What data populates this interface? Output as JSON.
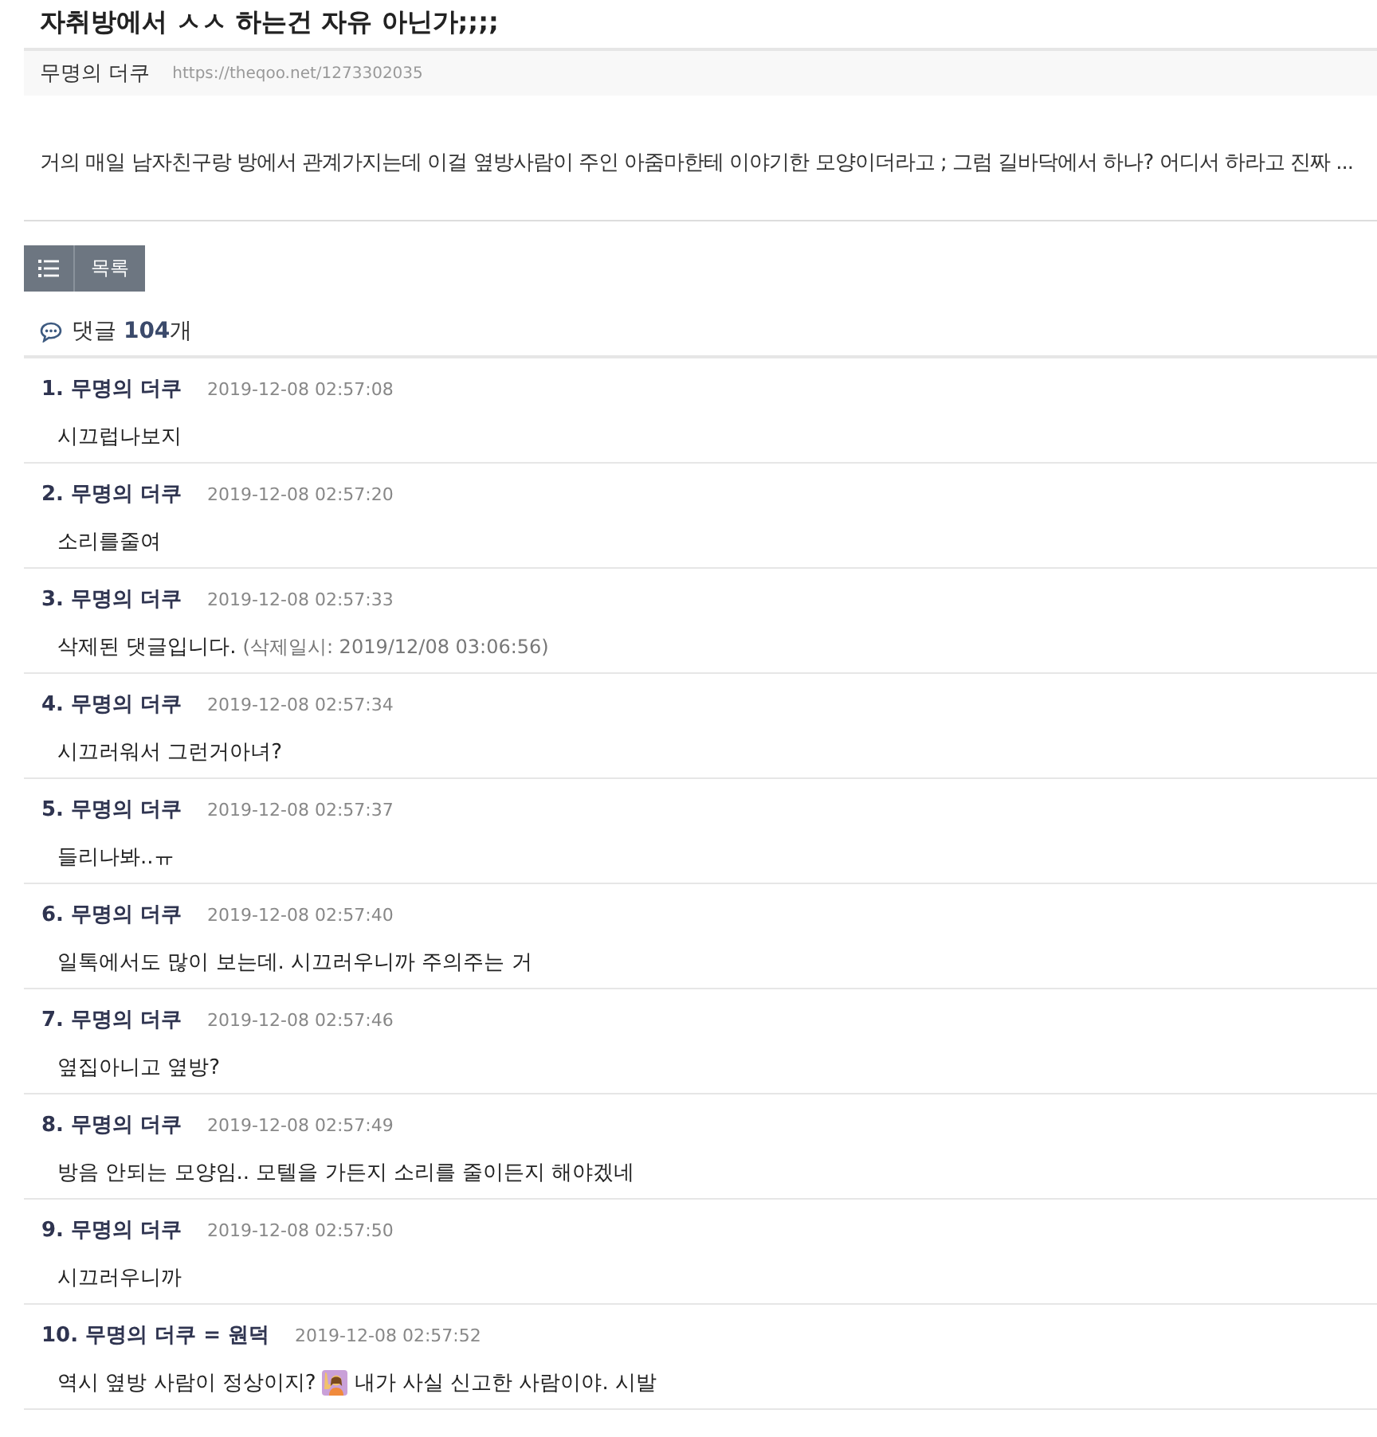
{
  "title": "자취방에서 ㅅㅅ 하는건 자유 아닌가;;;;",
  "meta": {
    "author": "무명의 더쿠",
    "url": "https://theqoo.net/1273302035"
  },
  "body": "거의 매일 남자친구랑 방에서 관계가지는데 이걸 옆방사람이 주인 아줌마한테 이야기한 모양이더라고 ; 그럼 길바닥에서 하나? 어디서 하라고 진짜 ...",
  "list_button": {
    "label": "목록"
  },
  "comment_count": {
    "label": "댓글",
    "count": "104",
    "unit": "개"
  },
  "comments": [
    {
      "number": "1.",
      "author": "무명의 더쿠",
      "time": "2019-12-08 02:57:08",
      "parts": [
        {
          "kind": "text",
          "text": "시끄럽나보지"
        }
      ]
    },
    {
      "number": "2.",
      "author": "무명의 더쿠",
      "time": "2019-12-08 02:57:20",
      "parts": [
        {
          "kind": "text",
          "text": "소리를줄여"
        }
      ]
    },
    {
      "number": "3.",
      "author": "무명의 더쿠",
      "time": "2019-12-08 02:57:33",
      "parts": [
        {
          "kind": "text",
          "text": "삭제된 댓글입니다."
        },
        {
          "kind": "note",
          "text": "(삭제일시: 2019/12/08 03:06:56)"
        }
      ]
    },
    {
      "number": "4.",
      "author": "무명의 더쿠",
      "time": "2019-12-08 02:57:34",
      "parts": [
        {
          "kind": "text",
          "text": "시끄러워서 그런거아녀?"
        }
      ]
    },
    {
      "number": "5.",
      "author": "무명의 더쿠",
      "time": "2019-12-08 02:57:37",
      "parts": [
        {
          "kind": "text",
          "text": "들리나봐..ㅠ"
        }
      ]
    },
    {
      "number": "6.",
      "author": "무명의 더쿠",
      "time": "2019-12-08 02:57:40",
      "parts": [
        {
          "kind": "text",
          "text": "일톡에서도 많이 보는데. 시끄러우니까 주의주는 거"
        }
      ]
    },
    {
      "number": "7.",
      "author": "무명의 더쿠",
      "time": "2019-12-08 02:57:46",
      "parts": [
        {
          "kind": "text",
          "text": "옆집아니고 옆방?"
        }
      ]
    },
    {
      "number": "8.",
      "author": "무명의 더쿠",
      "time": "2019-12-08 02:57:49",
      "parts": [
        {
          "kind": "text",
          "text": "방음 안되는 모양임.. 모텔을 가든지 소리를 줄이든지 해야겠네"
        }
      ]
    },
    {
      "number": "9.",
      "author": "무명의 더쿠",
      "time": "2019-12-08 02:57:50",
      "parts": [
        {
          "kind": "text",
          "text": "시끄러우니까"
        }
      ]
    },
    {
      "number": "10.",
      "author": "무명의 더쿠 = 원덕",
      "time": "2019-12-08 02:57:52",
      "parts": [
        {
          "kind": "text",
          "text": "역시 옆방 사람이 정상이지?"
        },
        {
          "kind": "emoji"
        },
        {
          "kind": "text",
          "text": "내가 사실 신고한 사람이야. 시발"
        }
      ]
    }
  ]
}
